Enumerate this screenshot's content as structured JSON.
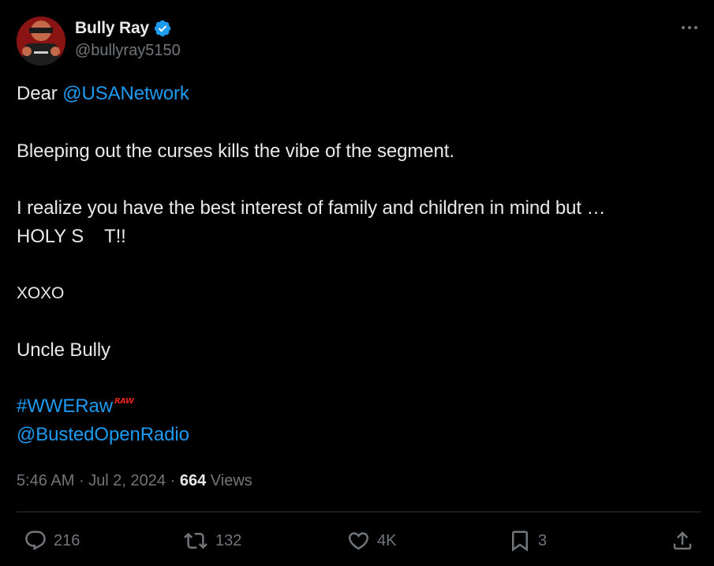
{
  "author": {
    "display_name": "Bully Ray",
    "handle": "@bullyray5150",
    "verified": true
  },
  "tweet": {
    "greeting": "Dear",
    "greeting_mention": "@USANetwork",
    "line_1": "Bleeping out the curses kills the vibe of the segment.",
    "line_2": "I realize you have the best interest of family and children in mind but …",
    "line_3": "HOLY S    T!!",
    "line_4": "XOXO",
    "line_5": "Uncle Bully",
    "hashtag": "#WWERaw",
    "hashtag_badge": "RAW",
    "mention_2": "@BustedOpenRadio"
  },
  "meta": {
    "time": "5:46 AM",
    "date": "Jul 2, 2024",
    "separator": "·",
    "views_count": "664",
    "views_label": "Views"
  },
  "actions": {
    "replies": "216",
    "reposts": "132",
    "likes": "4K",
    "bookmarks": "3"
  },
  "colors": {
    "background": "#000000",
    "text": "#e7e9ea",
    "muted": "#71767b",
    "link": "#1d9bf0",
    "verified": "#1d9bf0",
    "divider": "#2f3336",
    "raw_badge": "#e2231a"
  },
  "icons": {
    "more": "more-horizontal-icon",
    "verified": "verified-badge-icon",
    "reply": "reply-bubble-icon",
    "repost": "repost-icon",
    "like": "heart-icon",
    "bookmark": "bookmark-icon",
    "share": "share-upload-icon"
  }
}
